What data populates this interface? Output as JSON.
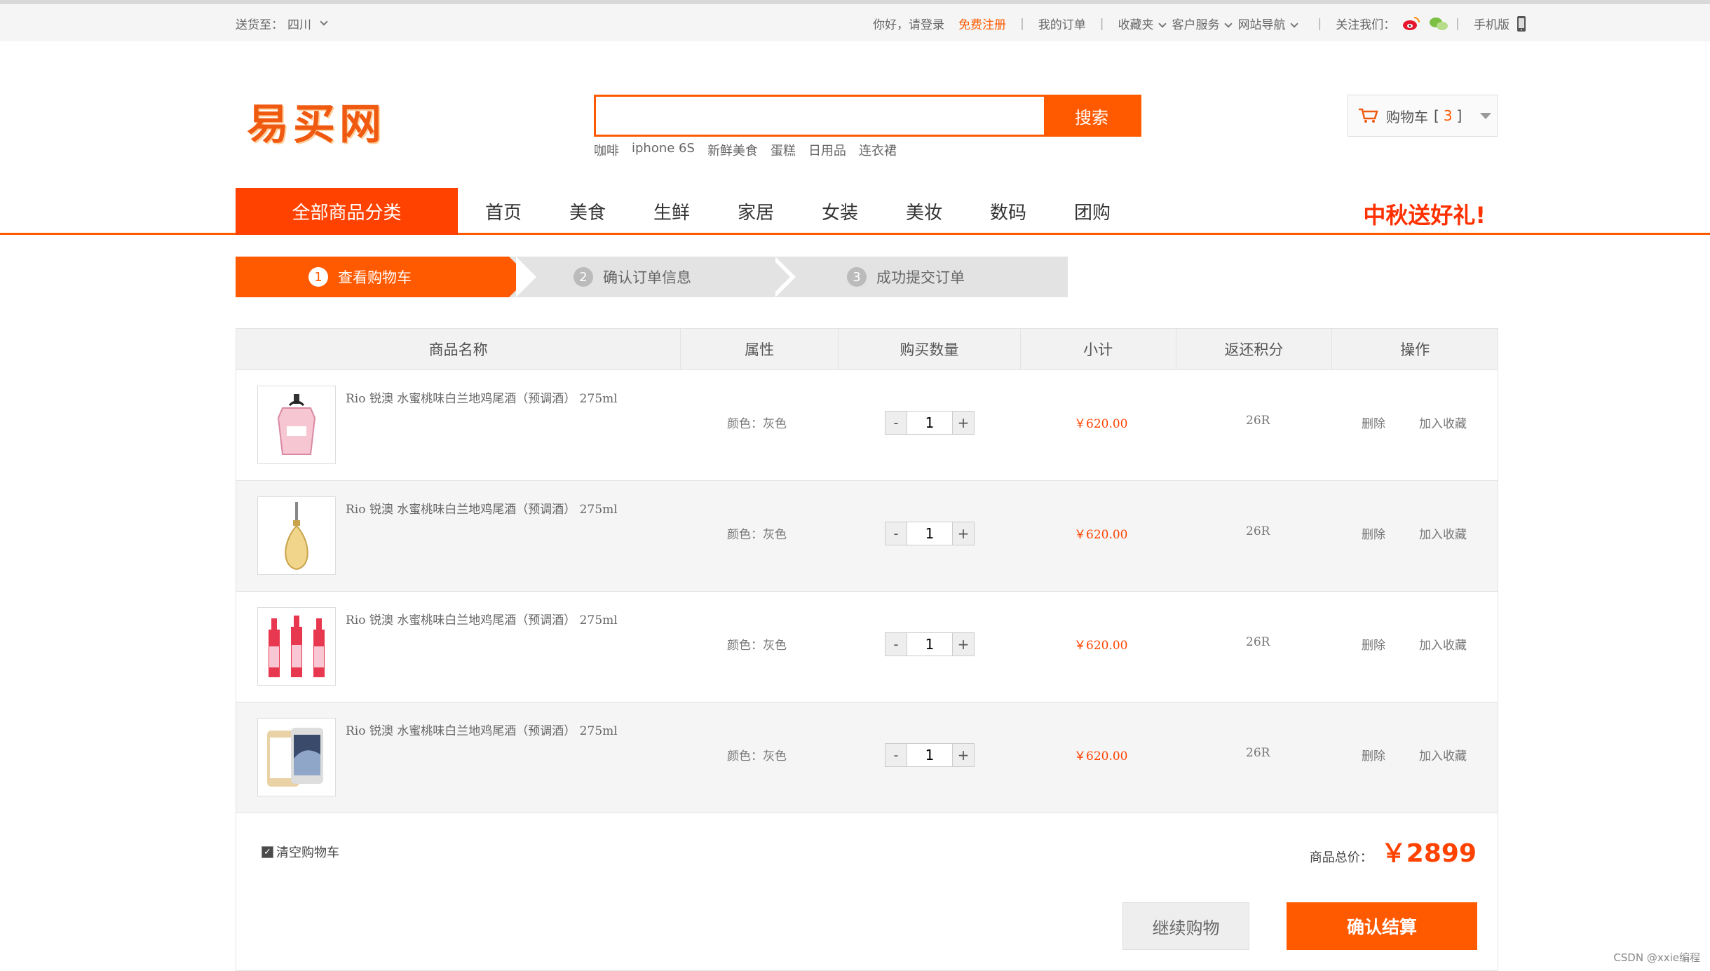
{
  "topbar": {
    "deliver_label": "送货至：",
    "deliver_region": "四川",
    "greeting": "你好，请登录",
    "register": "免费注册",
    "my_orders": "我的订单",
    "favorites": "收藏夹",
    "customer_service": "客户服务",
    "site_nav": "网站导航",
    "follow_us": "关注我们：",
    "mobile": "手机版"
  },
  "header": {
    "logo": "易买网",
    "search_placeholder": "",
    "search_button": "搜索",
    "hot_keywords": [
      "咖啡",
      "iphone 6S",
      "新鲜美食",
      "蛋糕",
      "日用品",
      "连衣裙"
    ],
    "cart_label": "购物车",
    "cart_count": "3"
  },
  "nav": {
    "all_categories": "全部商品分类",
    "items": [
      "首页",
      "美食",
      "生鲜",
      "家居",
      "女装",
      "美妆",
      "数码",
      "团购"
    ],
    "promo": "中秋送好礼!"
  },
  "steps": [
    {
      "num": "1",
      "label": "查看购物车"
    },
    {
      "num": "2",
      "label": "确认订单信息"
    },
    {
      "num": "3",
      "label": "成功提交订单"
    }
  ],
  "table": {
    "headers": [
      "商品名称",
      "属性",
      "购买数量",
      "小计",
      "返还积分",
      "操作"
    ],
    "rows": [
      {
        "name": "Rio 锐澳 水蜜桃味白兰地鸡尾酒（预调酒） 275ml",
        "attr": "颜色：灰色",
        "qty": "1",
        "subtotal": "￥620.00",
        "points": "26R",
        "delete": "删除",
        "favorite": "加入收藏",
        "thumb": "perfume-pink"
      },
      {
        "name": "Rio 锐澳 水蜜桃味白兰地鸡尾酒（预调酒） 275ml",
        "attr": "颜色：灰色",
        "qty": "1",
        "subtotal": "￥620.00",
        "points": "26R",
        "delete": "删除",
        "favorite": "加入收藏",
        "thumb": "perfume-gold"
      },
      {
        "name": "Rio 锐澳 水蜜桃味白兰地鸡尾酒（预调酒） 275ml",
        "attr": "颜色：灰色",
        "qty": "1",
        "subtotal": "￥620.00",
        "points": "26R",
        "delete": "删除",
        "favorite": "加入收藏",
        "thumb": "bottles"
      },
      {
        "name": "Rio 锐澳 水蜜桃味白兰地鸡尾酒（预调酒） 275ml",
        "attr": "颜色：灰色",
        "qty": "1",
        "subtotal": "￥620.00",
        "points": "26R",
        "delete": "删除",
        "favorite": "加入收藏",
        "thumb": "phone"
      }
    ],
    "qty_minus": "-",
    "qty_plus": "+"
  },
  "footer": {
    "clear_cart": "清空购物车",
    "total_label": "商品总价：",
    "total_value": "￥2899",
    "continue_button": "继续购物",
    "checkout_button": "确认结算"
  },
  "watermark": "CSDN @xxie编程",
  "colors": {
    "accent": "#ff5a00",
    "nav_accent": "#ff4200"
  }
}
